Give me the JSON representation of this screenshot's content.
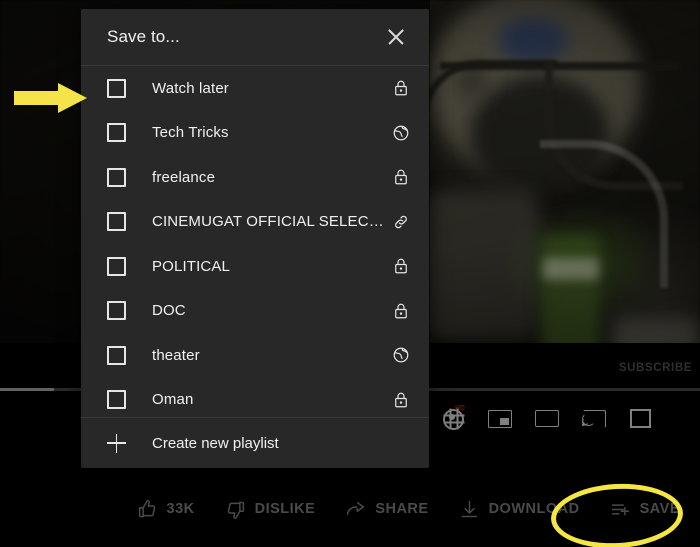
{
  "dialog": {
    "title": "Save to...",
    "close_icon": "close-icon",
    "playlists": [
      {
        "label": "Watch later",
        "privacy": "private",
        "privacy_icon": "lock-icon",
        "checked": false
      },
      {
        "label": "Tech Tricks",
        "privacy": "public",
        "privacy_icon": "globe-icon",
        "checked": false
      },
      {
        "label": "freelance",
        "privacy": "private",
        "privacy_icon": "lock-icon",
        "checked": false
      },
      {
        "label": "CINEMUGAT OFFICIAL SELECTION",
        "privacy": "unlisted",
        "privacy_icon": "link-icon",
        "checked": false
      },
      {
        "label": "POLITICAL",
        "privacy": "private",
        "privacy_icon": "lock-icon",
        "checked": false
      },
      {
        "label": "DOC",
        "privacy": "private",
        "privacy_icon": "lock-icon",
        "checked": false
      },
      {
        "label": "theater",
        "privacy": "public",
        "privacy_icon": "globe-icon",
        "checked": false
      },
      {
        "label": "Oman",
        "privacy": "private",
        "privacy_icon": "lock-icon",
        "checked": false
      }
    ],
    "create_new": {
      "label": "Create new playlist",
      "icon": "plus-icon"
    }
  },
  "action_bar": {
    "items": [
      {
        "label": "33K",
        "icon": "thumbs-up-icon",
        "name": "like-button"
      },
      {
        "label": "DISLIKE",
        "icon": "thumbs-down-icon",
        "name": "dislike-button"
      },
      {
        "label": "SHARE",
        "icon": "share-icon",
        "name": "share-button"
      },
      {
        "label": "DOWNLOAD",
        "icon": "download-icon",
        "name": "download-button"
      },
      {
        "label": "SAVE",
        "icon": "playlist-add-icon",
        "name": "save-button"
      }
    ]
  },
  "player": {
    "subscribe_label": "SUBSCRIBE",
    "quality_badge": "HD",
    "controls": [
      {
        "name": "settings-gear-icon"
      },
      {
        "name": "miniplayer-icon"
      },
      {
        "name": "theater-mode-icon"
      },
      {
        "name": "cast-icon"
      },
      {
        "name": "fullscreen-icon"
      }
    ]
  },
  "annotations": {
    "arrow_color": "#f5e34a",
    "ellipse_color": "#f5e642",
    "arrow_target": "watch-later-checkbox",
    "ellipse_target": "save-button"
  },
  "watermark": {
    "text": ""
  }
}
